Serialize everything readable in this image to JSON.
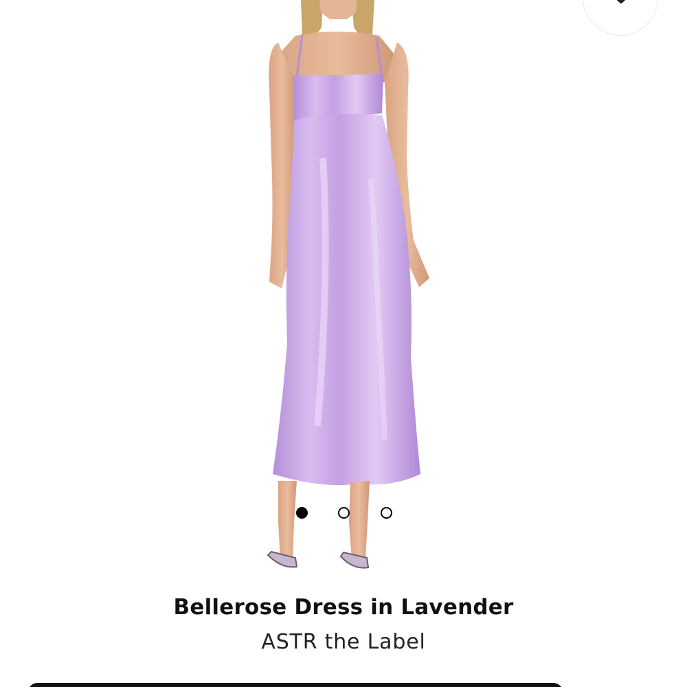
{
  "product": {
    "title": "Bellerose Dress in Lavender",
    "brand": "ASTR the Label",
    "image": {
      "subject": "model wearing lavender satin midi slip dress with cutout bodice",
      "dress_color": "#c9a6e6",
      "background": "#ffffff"
    }
  },
  "carousel": {
    "count": 3,
    "active_index": 0
  },
  "icons": {
    "wishlist": "heart-icon"
  },
  "colors": {
    "text": "#111111",
    "dot_active": "#000000"
  }
}
